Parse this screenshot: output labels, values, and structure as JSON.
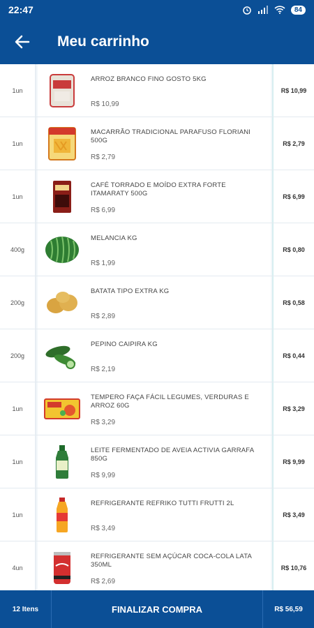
{
  "status": {
    "time": "22:47",
    "battery": "84"
  },
  "header": {
    "title": "Meu carrinho"
  },
  "items": [
    {
      "qty": "1un",
      "name": "ARROZ BRANCO FINO GOSTO 5KG",
      "unit_price": "R$ 10,99",
      "total": "R$ 10,99",
      "icon": "rice-bag-icon"
    },
    {
      "qty": "1un",
      "name": "MACARRÃO TRADICIONAL PARAFUSO FLORIANI 500G",
      "unit_price": "R$ 2,79",
      "total": "R$ 2,79",
      "icon": "pasta-package-icon"
    },
    {
      "qty": "1un",
      "name": "CAFÉ TORRADO E MOÍDO EXTRA FORTE ITAMARATY 500G",
      "unit_price": "R$ 6,99",
      "total": "R$ 6,99",
      "icon": "coffee-package-icon"
    },
    {
      "qty": "400g",
      "name": "MELANCIA KG",
      "unit_price": "R$ 1,99",
      "total": "R$ 0,80",
      "icon": "watermelon-icon"
    },
    {
      "qty": "200g",
      "name": "BATATA TIPO EXTRA KG",
      "unit_price": "R$ 2,89",
      "total": "R$ 0,58",
      "icon": "potato-icon"
    },
    {
      "qty": "200g",
      "name": "PEPINO CAIPIRA KG",
      "unit_price": "R$ 2,19",
      "total": "R$ 0,44",
      "icon": "cucumber-icon"
    },
    {
      "qty": "1un",
      "name": "TEMPERO FAÇA FÁCIL LEGUMES, VERDURAS E ARROZ 60G",
      "unit_price": "R$ 3,29",
      "total": "R$ 3,29",
      "icon": "seasoning-box-icon"
    },
    {
      "qty": "1un",
      "name": "LEITE FERMENTADO DE AVEIA ACTIVIA GARRAFA 850G",
      "unit_price": "R$ 9,99",
      "total": "R$ 9,99",
      "icon": "yogurt-bottle-icon"
    },
    {
      "qty": "1un",
      "name": "REFRIGERANTE REFRIKO TUTTI FRUTTI 2L",
      "unit_price": "R$ 3,49",
      "total": "R$ 3,49",
      "icon": "soda-bottle-icon"
    },
    {
      "qty": "4un",
      "name": "REFRIGERANTE SEM AÇÚCAR COCA-COLA LATA 350ML",
      "unit_price": "R$ 2,69",
      "total": "R$ 10,76",
      "icon": "soda-can-icon"
    }
  ],
  "footer": {
    "count": "12 Itens",
    "action": "FINALIZAR COMPRA",
    "total": "R$ 56,59"
  }
}
